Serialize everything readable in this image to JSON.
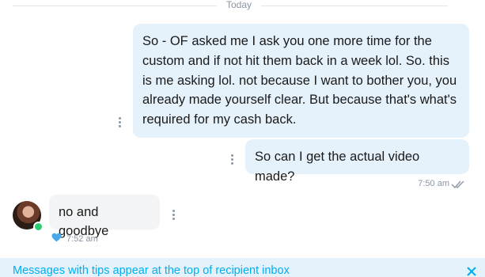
{
  "divider": {
    "label": "Today"
  },
  "messages_out": [
    {
      "text": "So - OF asked me I ask you one more time for the custom and if not hit them back in a week lol. So. this is me asking lol. not because I want to bother you, you already made yourself clear. But because that's what's required for my cash back."
    },
    {
      "text": "So can I get the actual video made?"
    }
  ],
  "out_meta": {
    "time": "7:50 am",
    "status_icon": "double-check-icon"
  },
  "message_in": {
    "text": "no and goodbye",
    "time": "7:52 am",
    "reaction_icon": "heart-icon"
  },
  "notice": {
    "text": "Messages with tips appear at the top of recipient inbox",
    "close_icon": "close-icon"
  },
  "colors": {
    "accent": "#00aff0",
    "bubble_out": "#e5f2fb",
    "bubble_in": "#f2f4f5",
    "muted": "#8a96a3",
    "online": "#2ecc71"
  }
}
